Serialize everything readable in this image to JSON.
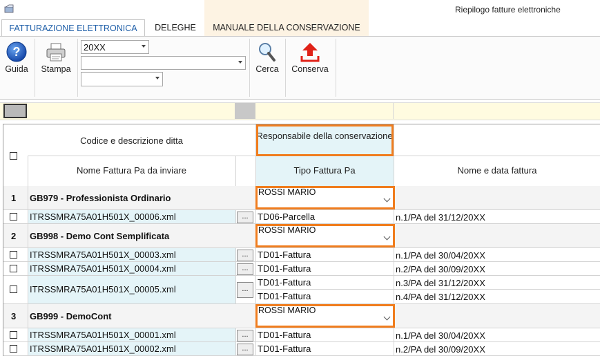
{
  "window": {
    "title": "Riepilogo fatture elettroniche"
  },
  "tabs": [
    {
      "label": "FATTURAZIONE ELETTRONICA",
      "active": true
    },
    {
      "label": "DELEGHE"
    },
    {
      "label": "MANUALE DELLA CONSERVAZIONE"
    }
  ],
  "toolbar": {
    "guida_label": "Guida",
    "stampa_label": "Stampa",
    "year_value": "20XX",
    "company_value": "",
    "third_value": "",
    "cerca_label": "Cerca",
    "conserva_label": "Conserva"
  },
  "grid": {
    "headers": {
      "codice": "Codice e descrizione ditta",
      "responsabile": "Responsabile della conservazione",
      "nome_fattura": "Nome Fattura Pa da inviare",
      "tipo": "Tipo Fattura Pa",
      "nome_data": "Nome e data fattura"
    },
    "groups": [
      {
        "num": "1",
        "ditta": "GB979 - Professionista Ordinario",
        "responsabile": "ROSSI MARIO",
        "files": [
          {
            "file": "ITRSSMRA75A01H501X_00006.xml",
            "dots": "...",
            "tipi": [
              "TD06-Parcella"
            ],
            "fatture": [
              "n.1/PA del 31/12/20XX"
            ]
          }
        ]
      },
      {
        "num": "2",
        "ditta": "GB998 - Demo Cont Semplificata",
        "responsabile": "ROSSI MARIO",
        "files": [
          {
            "file": "ITRSSMRA75A01H501X_00003.xml",
            "dots": "...",
            "tipi": [
              "TD01-Fattura"
            ],
            "fatture": [
              "n.1/PA del 30/04/20XX"
            ]
          },
          {
            "file": "ITRSSMRA75A01H501X_00004.xml",
            "dots": "...",
            "tipi": [
              "TD01-Fattura"
            ],
            "fatture": [
              "n.2/PA del 30/09/20XX"
            ]
          },
          {
            "file": "ITRSSMRA75A01H501X_00005.xml",
            "dots": "...",
            "tipi": [
              "TD01-Fattura",
              "TD01-Fattura"
            ],
            "fatture": [
              "n.3/PA del 31/12/20XX",
              "n.4/PA del 31/12/20XX"
            ]
          }
        ]
      },
      {
        "num": "3",
        "ditta": "GB999 - DemoCont",
        "responsabile": "ROSSI MARIO",
        "files": [
          {
            "file": "ITRSSMRA75A01H501X_00001.xml",
            "dots": "...",
            "tipi": [
              "TD01-Fattura"
            ],
            "fatture": [
              "n.1/PA del 30/04/20XX"
            ]
          },
          {
            "file": "ITRSSMRA75A01H501X_00002.xml",
            "dots": "...",
            "tipi": [
              "TD01-Fattura"
            ],
            "fatture": [
              "n.2/PA del 30/09/20XX"
            ]
          }
        ]
      }
    ]
  },
  "colors": {
    "highlight": "#f07d1e",
    "cyan_cell": "#e4f4f8",
    "tab_active_text": "#1f5fa8"
  }
}
